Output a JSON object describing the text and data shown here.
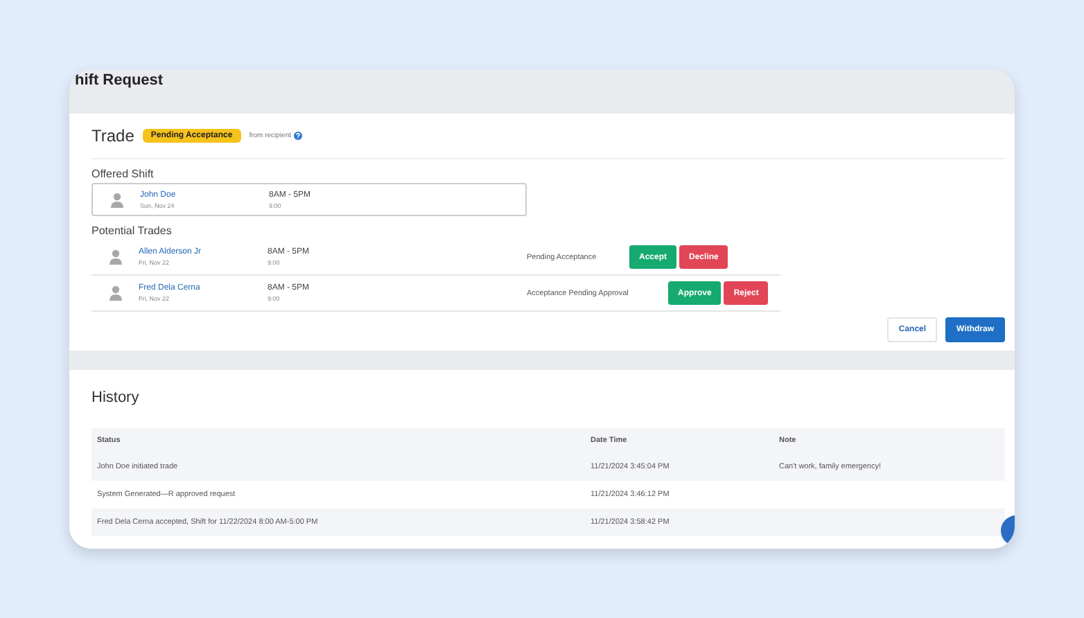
{
  "header": {
    "title": "hift Request"
  },
  "trade": {
    "title": "Trade",
    "badge": "Pending Acceptance",
    "badge_note": "from recipient",
    "offered_label": "Offered Shift",
    "offered": {
      "name": "John Doe",
      "date": "Sun, Nov 24",
      "time": "8AM - 5PM",
      "hours": "9:00"
    },
    "potential_label": "Potential Trades",
    "trades": [
      {
        "name": "Allen Alderson Jr",
        "date": "Fri, Nov 22",
        "time": "8AM - 5PM",
        "hours": "9:00",
        "status": "Pending Acceptance",
        "actions": [
          {
            "label": "Accept",
            "kind": "positive"
          },
          {
            "label": "Decline",
            "kind": "negative"
          }
        ]
      },
      {
        "name": "Fred Dela Cerna",
        "date": "Fri, Nov 22",
        "time": "8AM - 5PM",
        "hours": "9:00",
        "status": "Acceptance Pending Approval",
        "actions": [
          {
            "label": "Approve",
            "kind": "positive"
          },
          {
            "label": "Reject",
            "kind": "negative"
          }
        ]
      }
    ],
    "footer_buttons": [
      {
        "label": "Cancel",
        "kind": "secondary"
      },
      {
        "label": "Withdraw",
        "kind": "primary"
      }
    ]
  },
  "history": {
    "title": "History",
    "columns": [
      "Status",
      "Date Time",
      "Note"
    ],
    "rows": [
      [
        "John Doe initiated trade",
        "11/21/2024 3:45:04 PM",
        "Can't work, family emergency!"
      ],
      [
        "System Generated—R approved request",
        "11/21/2024 3:46:12 PM",
        ""
      ],
      [
        "Fred Dela Cerna accepted, Shift for 11/22/2024 8:00 AM-5:00 PM",
        "11/21/2024 3:58:42 PM",
        ""
      ]
    ]
  }
}
